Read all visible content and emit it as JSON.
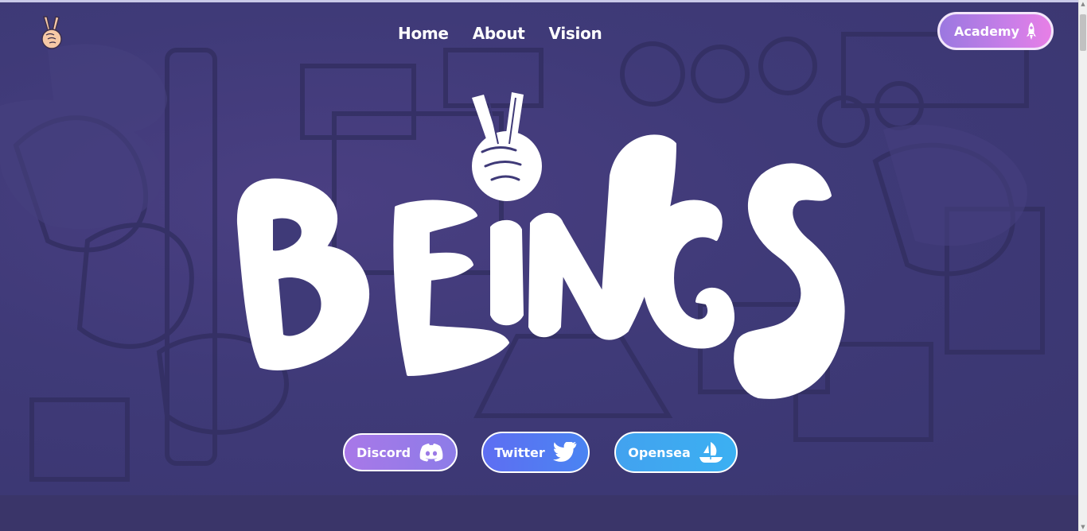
{
  "nav": {
    "logo_icon": "peace-hand-icon",
    "links": [
      "Home",
      "About",
      "Vision"
    ],
    "academy": {
      "label": "Academy",
      "icon": "rocket-icon"
    }
  },
  "hero": {
    "logo_word": "BEINGS",
    "logo_icon": "peace-hand-icon"
  },
  "social": [
    {
      "label": "Discord",
      "icon": "discord-icon"
    },
    {
      "label": "Twitter",
      "icon": "twitter-icon"
    },
    {
      "label": "Opensea",
      "icon": "opensea-icon"
    }
  ],
  "colors": {
    "background": "#3e3a72",
    "academy_gradient_start": "#9b78e0",
    "academy_gradient_end": "#e77fe6",
    "discord": "#a878e8",
    "twitter": "#5e6ef2",
    "opensea": "#3bb0f2"
  }
}
